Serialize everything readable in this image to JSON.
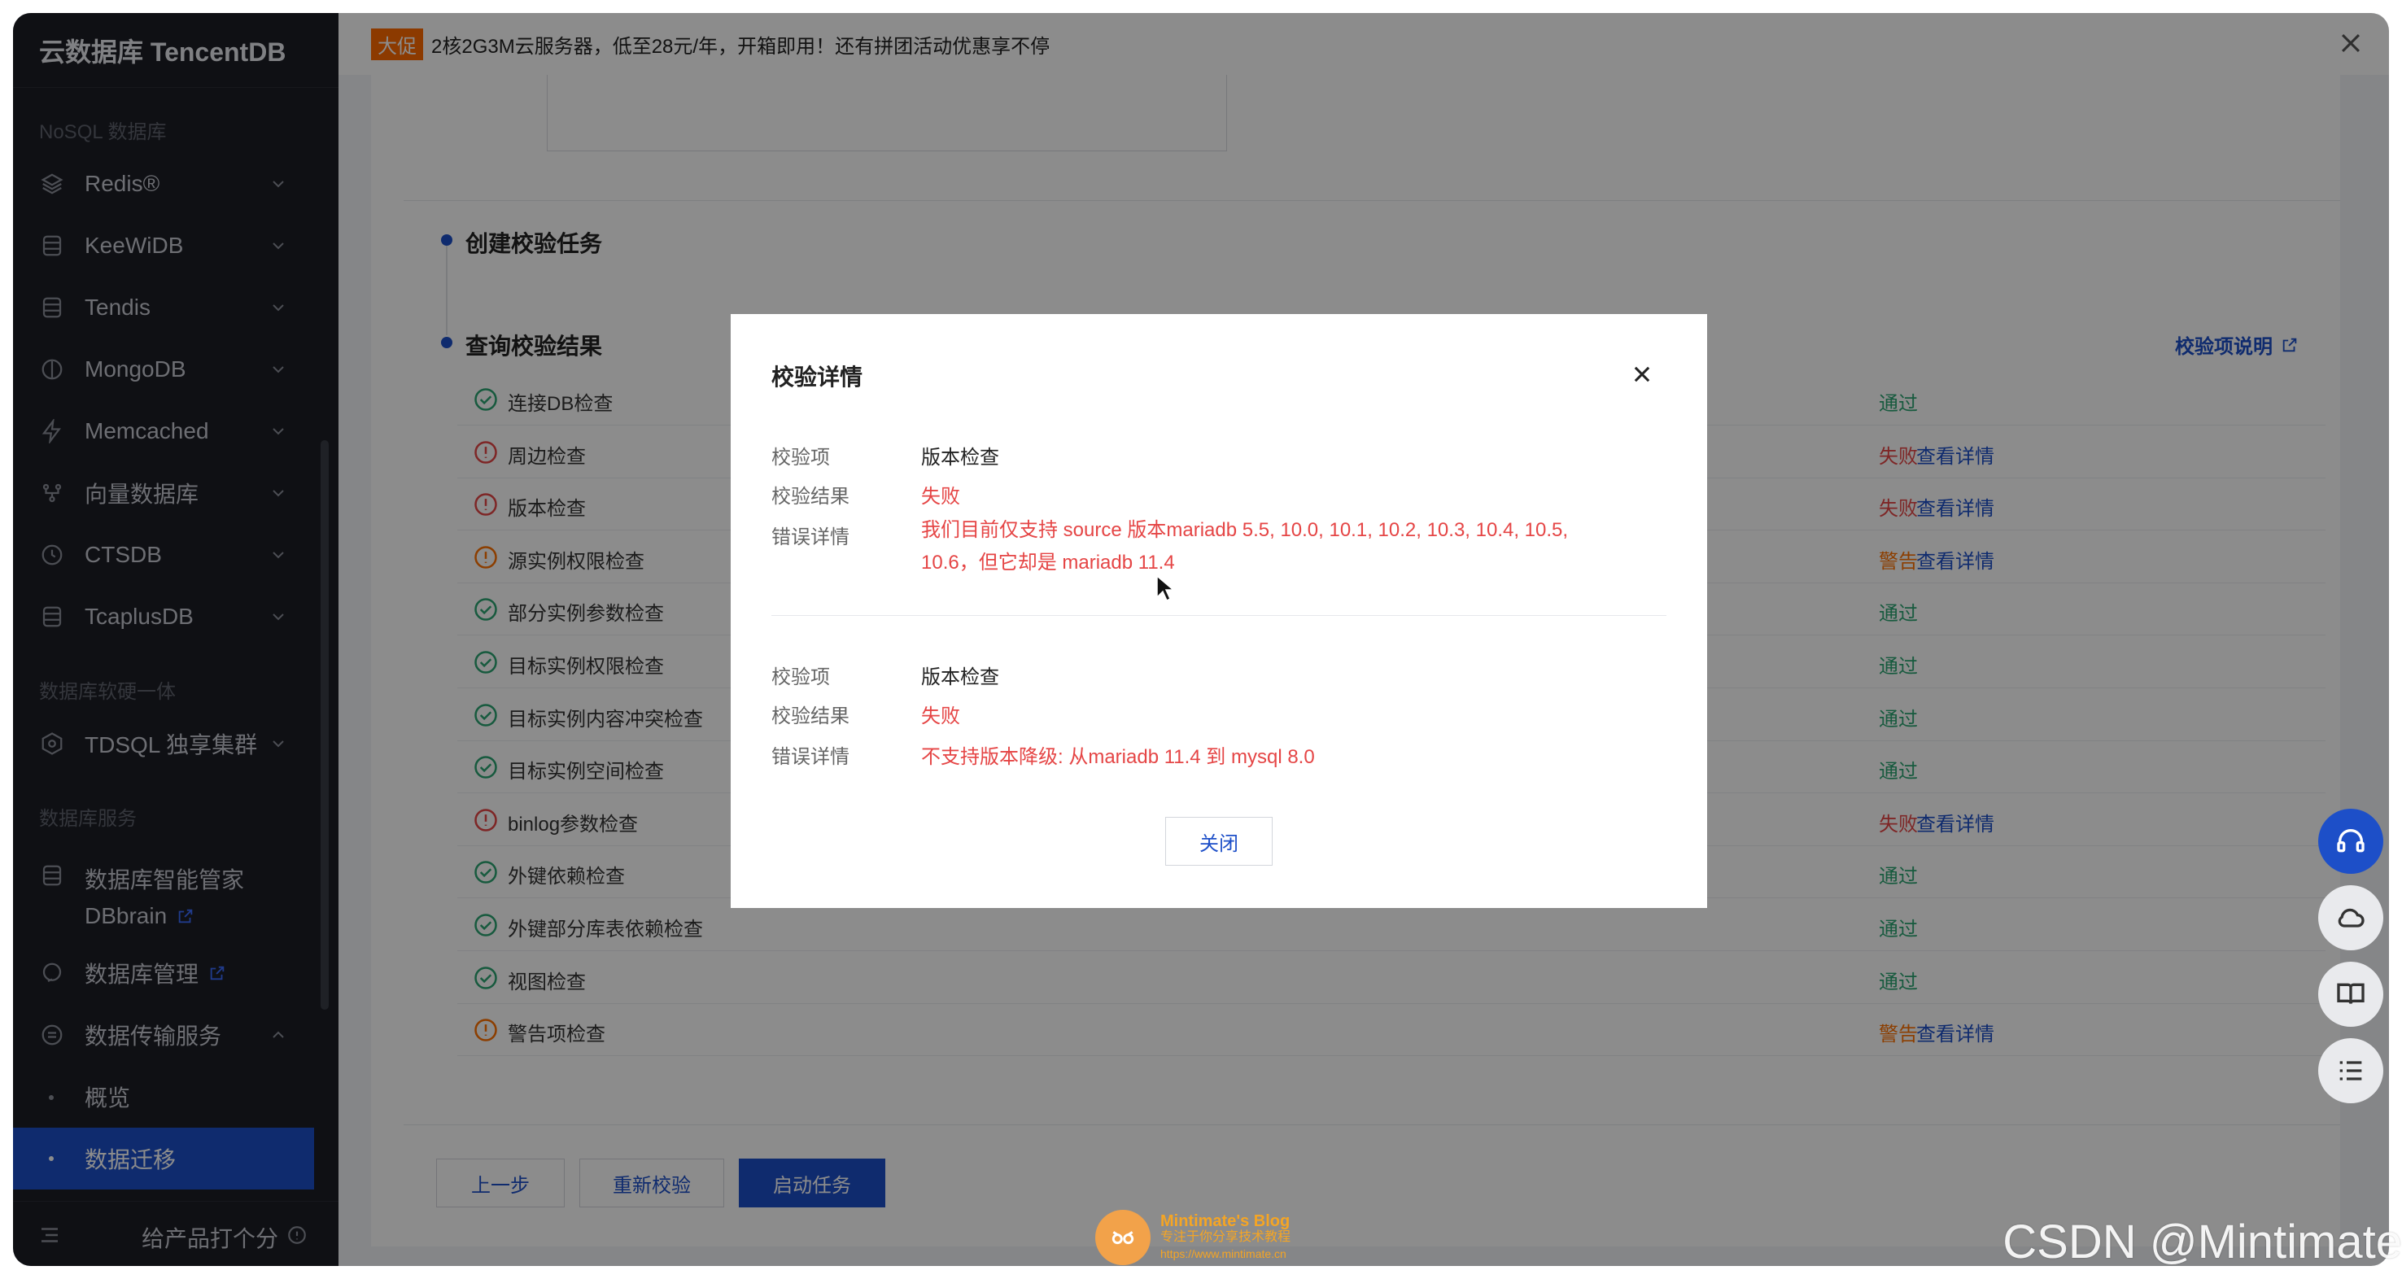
{
  "sidebar": {
    "brand": "云数据库 TencentDB",
    "section_nosql": "NoSQL 数据库",
    "items": [
      {
        "label": "Redis®",
        "icon": "layers-icon"
      },
      {
        "label": "KeeWiDB",
        "icon": "database-icon"
      },
      {
        "label": "Tendis",
        "icon": "database-icon"
      },
      {
        "label": "MongoDB",
        "icon": "leaf-icon"
      },
      {
        "label": "Memcached",
        "icon": "bolt-icon"
      },
      {
        "label": "向量数据库",
        "icon": "vector-icon"
      },
      {
        "label": "CTSDB",
        "icon": "clock-icon"
      },
      {
        "label": "TcaplusDB",
        "icon": "database-icon"
      }
    ],
    "section_hw": "数据库软硬一体",
    "tdsql": "TDSQL 独享集群",
    "section_service": "数据库服务",
    "dbbrain_line1": "数据库智能管家",
    "dbbrain_line2": "DBbrain",
    "db_manage": "数据库管理",
    "dts": "数据传输服务",
    "dts_overview": "概览",
    "dts_migrate": "数据迁移",
    "rate": "给产品打个分"
  },
  "promo": {
    "tag": "大促",
    "text": "2核2G3M云服务器，低至28元/年，开箱即用！还有拼团活动优惠享不停"
  },
  "steps": {
    "create": "创建校验任务",
    "query": "查询校验结果",
    "help_link": "校验项说明"
  },
  "checks": [
    {
      "name": "连接DB检查",
      "status": "ok",
      "result": "通过",
      "link": ""
    },
    {
      "name": "周边检查",
      "status": "fail",
      "result": "失败",
      "link": "查看详情"
    },
    {
      "name": "版本检查",
      "status": "fail",
      "result": "失败",
      "link": "查看详情"
    },
    {
      "name": "源实例权限检查",
      "status": "warn",
      "result": "警告",
      "link": "查看详情"
    },
    {
      "name": "部分实例参数检查",
      "status": "ok",
      "result": "通过",
      "link": ""
    },
    {
      "name": "目标实例权限检查",
      "status": "ok",
      "result": "通过",
      "link": ""
    },
    {
      "name": "目标实例内容冲突检查",
      "status": "ok",
      "result": "通过",
      "link": ""
    },
    {
      "name": "目标实例空间检查",
      "status": "ok",
      "result": "通过",
      "link": ""
    },
    {
      "name": "binlog参数检查",
      "status": "fail",
      "result": "失败",
      "link": "查看详情"
    },
    {
      "name": "外键依赖检查",
      "status": "ok",
      "result": "通过",
      "link": ""
    },
    {
      "name": "外键部分库表依赖检查",
      "status": "ok",
      "result": "通过",
      "link": ""
    },
    {
      "name": "视图检查",
      "status": "ok",
      "result": "通过",
      "link": ""
    },
    {
      "name": "警告项检查",
      "status": "warn",
      "result": "警告",
      "link": "查看详情"
    }
  ],
  "buttons": {
    "prev": "上一步",
    "recheck": "重新校验",
    "start": "启动任务"
  },
  "modal": {
    "title": "校验详情",
    "label_item": "校验项",
    "label_result": "校验结果",
    "label_error": "错误详情",
    "entries": [
      {
        "item": "版本检查",
        "result": "失败",
        "error": "我们目前仅支持 source 版本mariadb 5.5, 10.0, 10.1, 10.2, 10.3, 10.4, 10.5, 10.6，但它却是 mariadb 11.4"
      },
      {
        "item": "版本检查",
        "result": "失败",
        "error": "不支持版本降级: 从mariadb 11.4 到 mysql 8.0"
      }
    ],
    "close_button": "关闭"
  },
  "watermark": {
    "blog_title": "Mintimate's Blog",
    "blog_sub": "专注于你分享技术教程",
    "blog_url": "https://www.mintimate.cn",
    "csdn": "CSDN @Mintimate"
  },
  "colors": {
    "accent": "#1d4fc8",
    "pass": "#2ba471",
    "fail": "#e54545",
    "warn": "#ff7200",
    "sidebar_bg": "#1c1e26"
  }
}
